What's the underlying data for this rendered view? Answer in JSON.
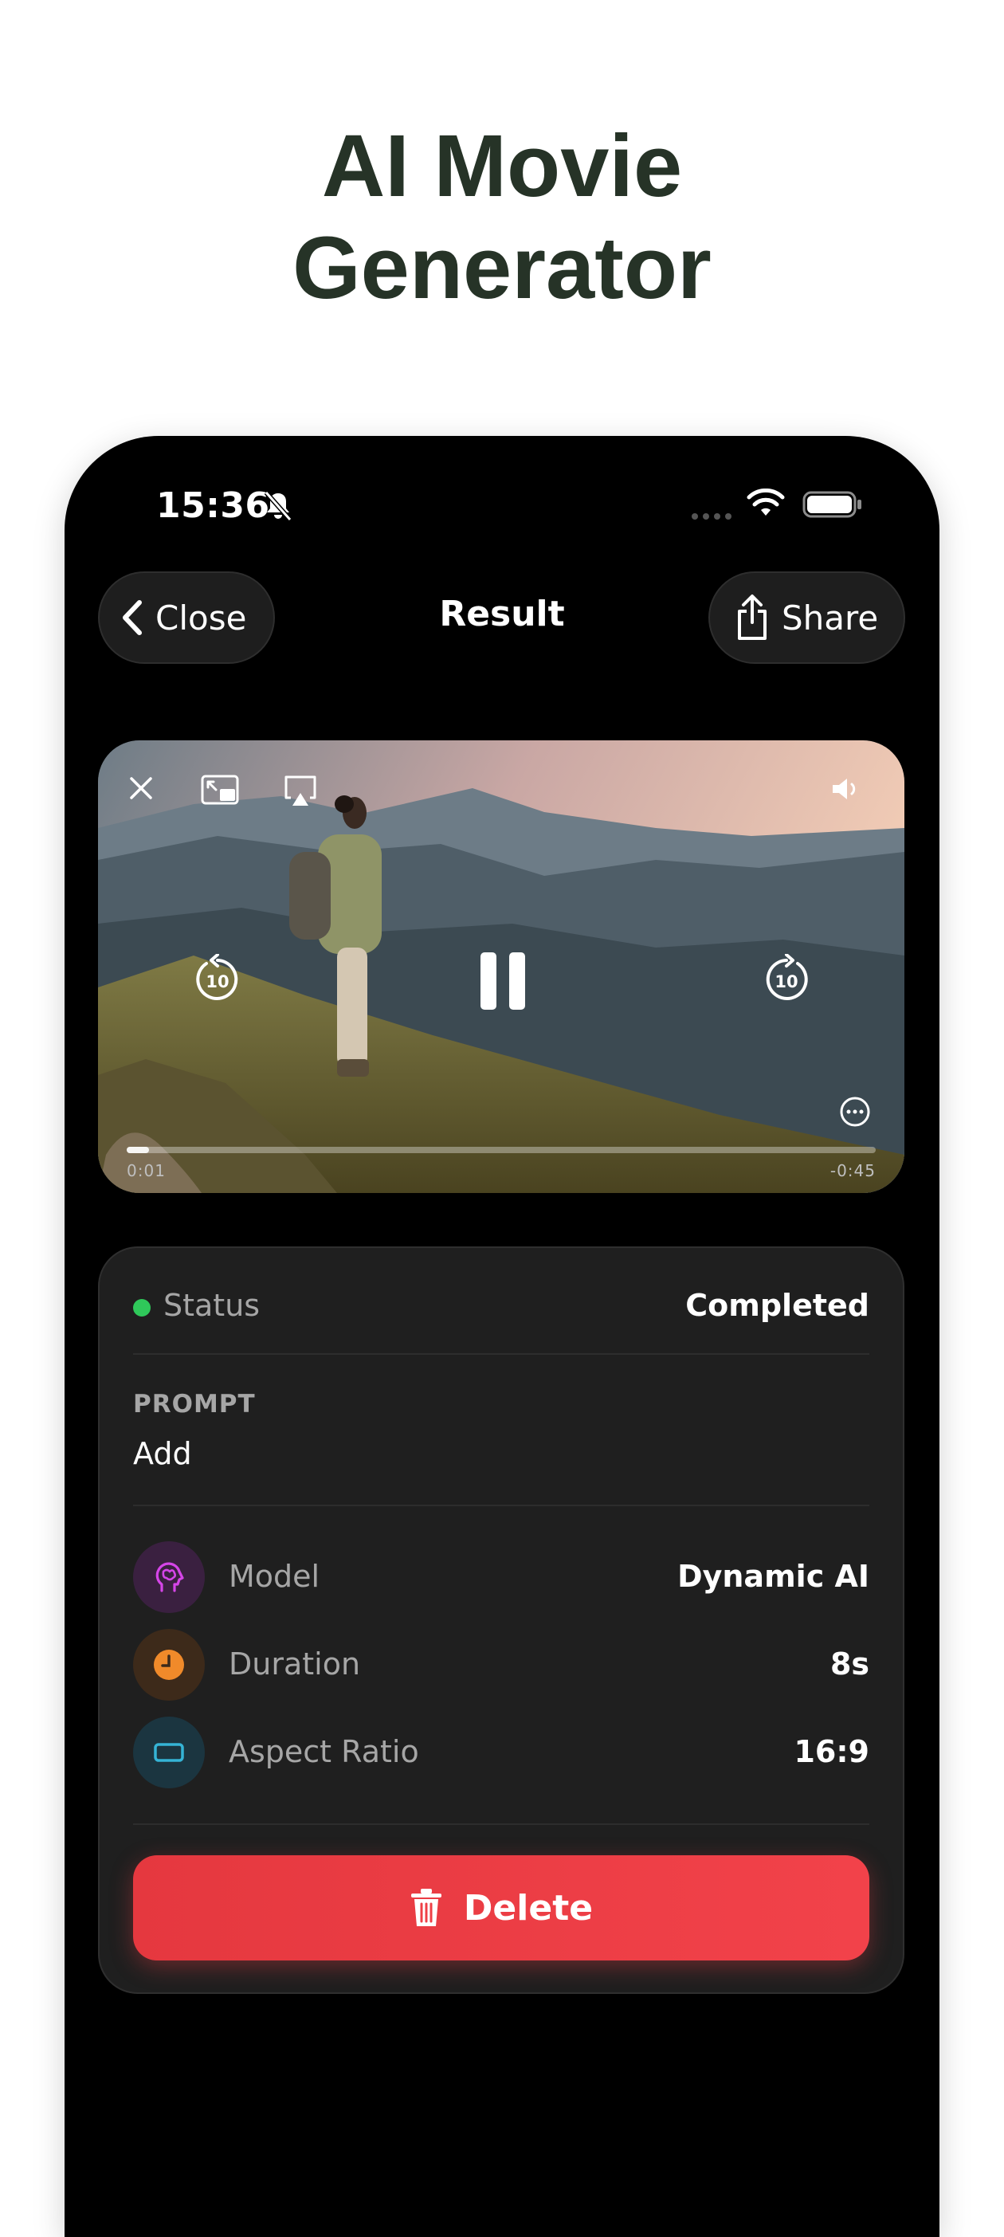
{
  "headline": {
    "line1": "AI Movie",
    "line2": "Generator"
  },
  "status_bar": {
    "time": "15:36"
  },
  "nav": {
    "close_label": "Close",
    "title": "Result",
    "share_label": "Share"
  },
  "player": {
    "elapsed": "0:01",
    "remaining": "-0:45",
    "skip_seconds": "10",
    "progress": 0.03
  },
  "details": {
    "status_label": "Status",
    "status_value": "Completed",
    "status_color": "#2fc85a",
    "prompt_label": "PROMPT",
    "prompt_value": "Add",
    "specs": [
      {
        "label": "Model",
        "value": "Dynamic AI",
        "icon": "brain-head-icon",
        "accent": "#c63ad6"
      },
      {
        "label": "Duration",
        "value": "8s",
        "icon": "clock-icon",
        "accent": "#f08a2a"
      },
      {
        "label": "Aspect Ratio",
        "value": "16:9",
        "icon": "aspect-ratio-icon",
        "accent": "#35b4d6"
      }
    ],
    "delete_label": "Delete",
    "delete_color": "#ef3f46"
  }
}
